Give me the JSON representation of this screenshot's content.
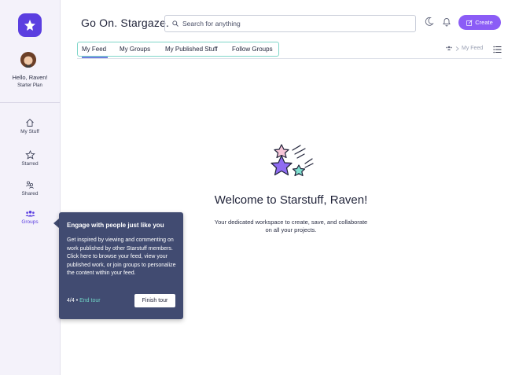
{
  "app": {
    "title": "Go On. Stargaze."
  },
  "sidebar": {
    "greeting": "Hello, Raven!",
    "plan": "Starter Plan",
    "items": [
      {
        "label": "My Stuff",
        "icon": "home-icon"
      },
      {
        "label": "Starred",
        "icon": "star-icon"
      },
      {
        "label": "Shared",
        "icon": "shared-users-icon"
      },
      {
        "label": "Groups",
        "icon": "groups-icon",
        "active": true
      }
    ]
  },
  "search": {
    "placeholder": "Search for anything",
    "value": ""
  },
  "header": {
    "create_label": "Create"
  },
  "tabs": [
    {
      "label": "My Feed",
      "active": true
    },
    {
      "label": "My Groups"
    },
    {
      "label": "My Published Stuff"
    },
    {
      "label": "Follow Groups"
    }
  ],
  "breadcrumb": {
    "current": "My Feed"
  },
  "main": {
    "welcome": "Welcome to Starstuff, Raven!",
    "description": "Your dedicated workspace to create, save, and collaborate on all your projects."
  },
  "tour": {
    "title": "Engage with people just like you",
    "body": "Get inspired by viewing and commenting on work published by other Starstuff members. Click here to browse your feed, view your published work, or join groups to personalize the content within your feed.",
    "step": "4/4",
    "bullet": "•",
    "end_label": "End tour",
    "finish_label": "Finish tour"
  },
  "colors": {
    "accent": "#5b3fe0",
    "create_button": "#8b5cf6",
    "tooltip_bg": "#414b71",
    "tab_highlight": "#7fd6c9",
    "end_tour_link": "#6fd3c5"
  }
}
